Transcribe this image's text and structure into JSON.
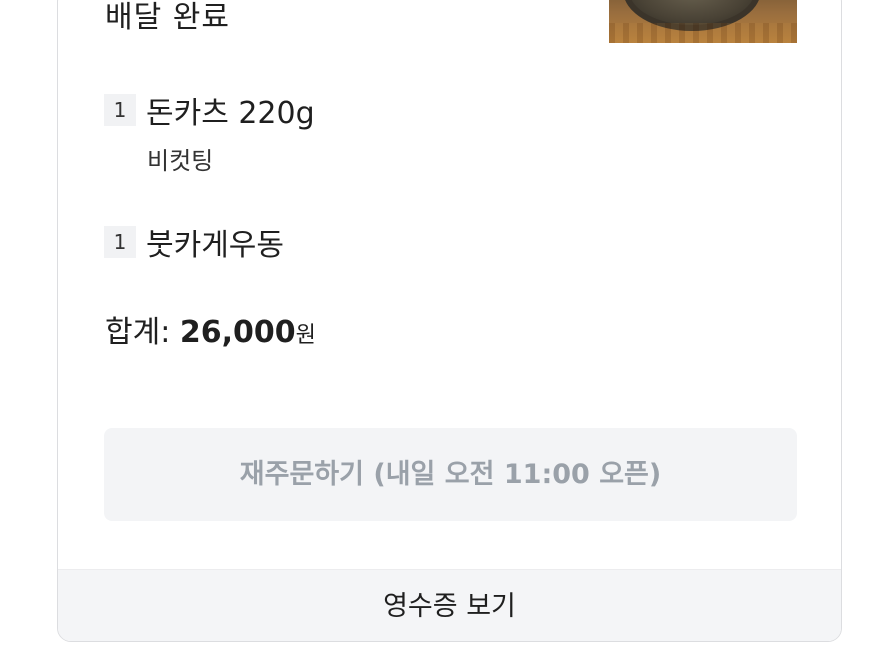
{
  "order": {
    "status": "배달 완료",
    "items": [
      {
        "qty": "1",
        "name": "돈카츠 220g",
        "option": "비컷팅"
      },
      {
        "qty": "1",
        "name": "붓카게우동"
      }
    ],
    "total_label": "합계: ",
    "total_amount": "26,000",
    "total_unit": "원"
  },
  "actions": {
    "reorder_label": "재주문하기 (내일 오전 11:00 오픈)",
    "receipt_label": "영수증 보기"
  },
  "colors": {
    "card_border": "#dcdde0",
    "button_bg": "#f3f4f6",
    "button_text_disabled": "#9aa1a9"
  }
}
